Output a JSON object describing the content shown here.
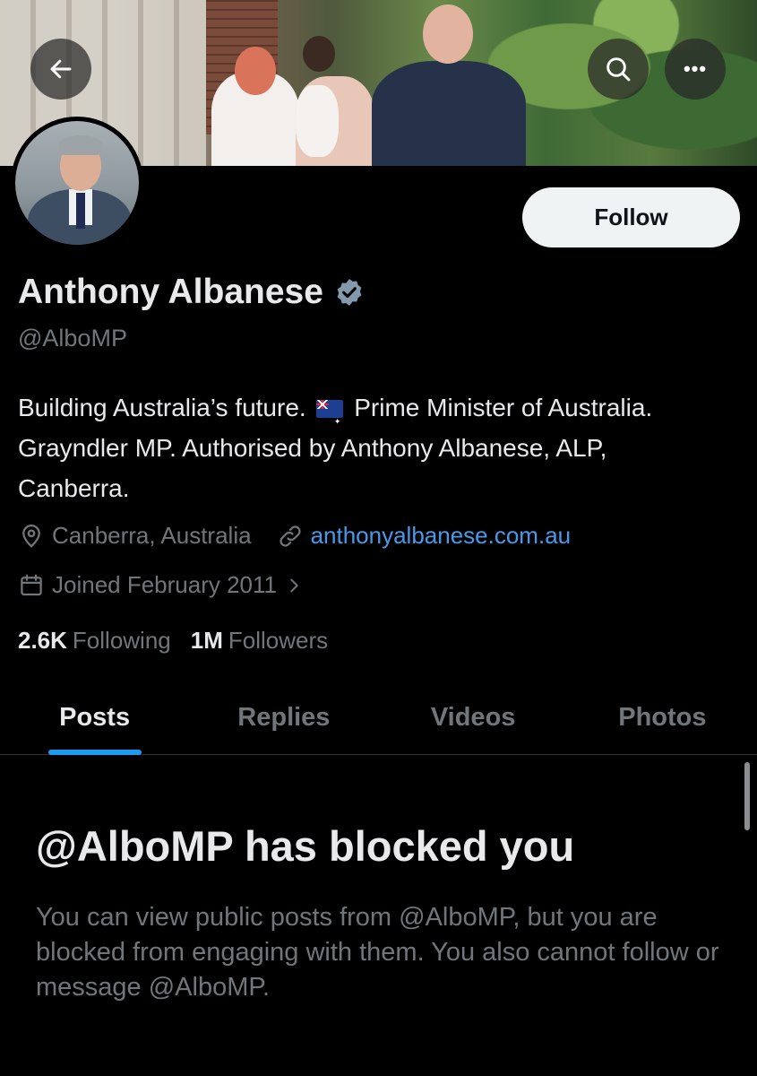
{
  "profile": {
    "name": "Anthony Albanese",
    "handle": "@AlboMP",
    "bio_part1": "Building Australia’s future.",
    "bio_part2": "Prime Minister of Australia. Grayndler MP. Authorised by Anthony Albanese, ALP, Canberra.",
    "location": "Canberra, Australia",
    "website": "anthonyalbanese.com.au",
    "joined": "Joined February 2011",
    "following_count": "2.6K",
    "following_label": "Following",
    "followers_count": "1M",
    "followers_label": "Followers",
    "verified": true
  },
  "actions": {
    "follow_label": "Follow",
    "more_label": "•••"
  },
  "tabs": [
    {
      "label": "Posts",
      "active": true
    },
    {
      "label": "Replies",
      "active": false
    },
    {
      "label": "Videos",
      "active": false
    },
    {
      "label": "Photos",
      "active": false
    }
  ],
  "blocked": {
    "title": "@AlboMP has blocked you",
    "description": "You can view public posts from @AlboMP, but you are blocked from engaging with them. You also cannot follow or message @AlboMP."
  },
  "colors": {
    "background": "#000000",
    "accent": "#1d9bf0",
    "link": "#4a99e9",
    "muted": "#71767b",
    "verified_badge": "#829aab"
  },
  "icons": [
    "back-arrow-icon",
    "search-icon",
    "more-icon",
    "verified-badge-icon",
    "location-pin-icon",
    "link-icon",
    "calendar-icon",
    "chevron-right-icon",
    "australian-flag-emoji"
  ]
}
